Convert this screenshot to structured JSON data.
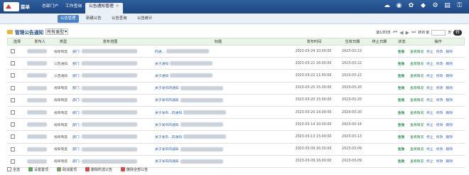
{
  "app": {
    "menu": "菜单"
  },
  "tabs": [
    {
      "label": "总部门户"
    },
    {
      "label": "工作查询"
    },
    {
      "label": "公告通知管理",
      "close": "×"
    }
  ],
  "subtabs": [
    {
      "label": "公告管理"
    },
    {
      "label": "新建公告"
    },
    {
      "label": "公告查询"
    },
    {
      "label": "公告统计"
    }
  ],
  "toolbar_icons": [
    "cloud-icon",
    "disk-icon",
    "flower-icon",
    "app-icon",
    "gear-icon",
    "document-icon",
    "key-icon"
  ],
  "page": {
    "title": "管理公告通知",
    "type_select": "所有类型"
  },
  "pager": {
    "info": "第1/83页",
    "jump_label": "转到 第",
    "page": "页",
    "go_label": "转"
  },
  "table": {
    "headers": [
      "选择",
      "发布人",
      "类型",
      "发布范围",
      "标题",
      "发布时间",
      "生效日期",
      "终止日期",
      "状态",
      "操作"
    ],
    "rows": [
      {
        "type": "规章制度",
        "dept": "部门:",
        "title": "的通...",
        "time": "2023-03-24 10:00:00",
        "effective": "2023-03-23",
        "status": "生效",
        "ops": [
          "查阅情况",
          "终止",
          "修改",
          "删除"
        ]
      },
      {
        "type": "公告通知",
        "dept": "部门:",
        "title": "关于通知",
        "time": "2023-03-22 16:00:00",
        "effective": "2023-03-22",
        "status": "生效",
        "ops": [
          "查阅情况",
          "终止",
          "修改",
          "删除"
        ]
      },
      {
        "type": "公告通知",
        "dept": "部门:",
        "title": "关于通知",
        "time": "2023-03-22 11:00:00",
        "effective": "2023-03-22",
        "status": "生效",
        "ops": [
          "查阅情况",
          "终止",
          "修改",
          "删除"
        ]
      },
      {
        "type": "规章制度",
        "dept": "部门:",
        "title": "关于发布的通知",
        "time": "2023-03-20 15:30:00",
        "effective": "2023-03-20",
        "status": "生效",
        "ops": [
          "查阅情况",
          "终止",
          "修改",
          "删除"
        ]
      },
      {
        "type": "规章制度",
        "dept": "部门:",
        "title": "关于发布的通知",
        "time": "2023-03-20 15:00:00",
        "effective": "2023-03-20",
        "status": "生效",
        "ops": [
          "查阅情况",
          "终止",
          "修改",
          "删除"
        ]
      },
      {
        "type": "规章制度",
        "dept": "部门:",
        "title": "关于发布...的通知",
        "time": "2023-03-20 14:00:00",
        "effective": "2023-03-20",
        "status": "生效",
        "ops": [
          "查阅情况",
          "终止",
          "修改",
          "删除"
        ]
      },
      {
        "type": "规章制度",
        "dept": "部门:",
        "title": "关于发布的通知",
        "time": "2023-03-14 10:30:00",
        "effective": "2023-03-14",
        "status": "生效",
        "ops": [
          "查阅情况",
          "终止",
          "修改",
          "删除"
        ]
      },
      {
        "type": "规章制度",
        "dept": "部门:",
        "title": "关于发布...的通知",
        "time": "2023-03-13 15:00:00",
        "effective": "2023-03-13",
        "status": "生效",
        "ops": [
          "查阅情况",
          "终止",
          "修改",
          "删除"
        ]
      },
      {
        "type": "规章制度",
        "dept": "部门:",
        "title": "关于发布的通知",
        "time": "2023-03-09 16:30:00",
        "effective": "2023-03-09",
        "status": "生效",
        "ops": [
          "查阅情况",
          "终止",
          "修改",
          "删除"
        ]
      },
      {
        "type": "规章制度",
        "dept": "部门:",
        "title": "关于发布的通知",
        "time": "2023-03-09 16:00:00",
        "effective": "2023-03-09",
        "status": "生效",
        "ops": [
          "查阅情况",
          "终止",
          "修改",
          "删除"
        ]
      }
    ]
  },
  "footer": {
    "select_all": "全选",
    "set_top": "设置置顶",
    "cancel_top": "取消置顶",
    "delete_selected": "删除所选公告",
    "delete_all": "删除全部公告"
  },
  "colors": {
    "topbar": "#1f4b86",
    "accent": "#4a80c5",
    "green": "#0b8a3e",
    "blue": "#2b5fb4"
  }
}
